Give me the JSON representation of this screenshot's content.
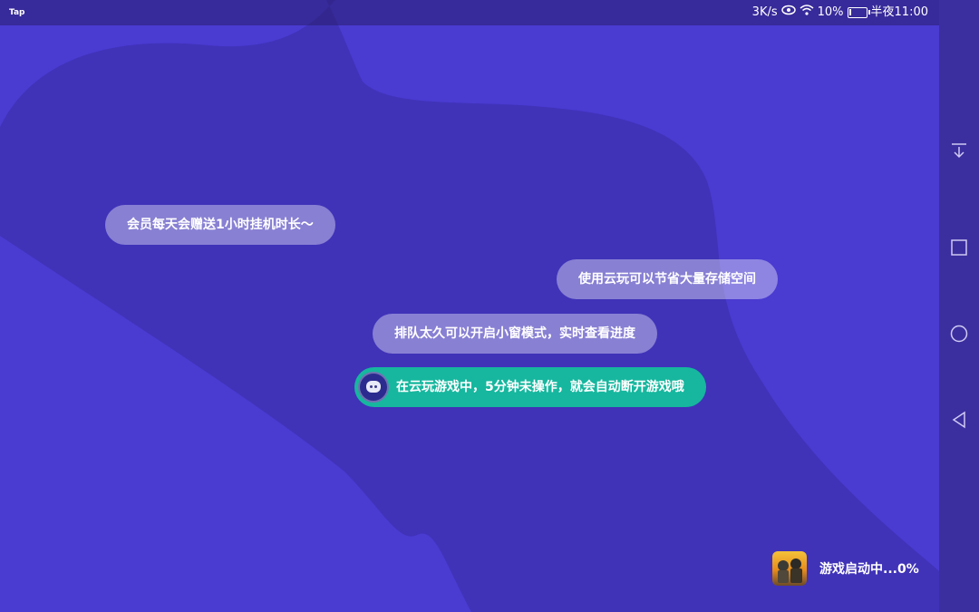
{
  "colors": {
    "background": "#4a3bd1",
    "background_dark": "#3f33b6",
    "navbar": "#3b2f9f",
    "bubble": "rgba(255,255,255,0.38)",
    "bubble_active": "#16b79e"
  },
  "statusbar": {
    "app_label": "Tap",
    "network_speed": "3K/s",
    "battery_percent": "10%",
    "time": "半夜11:00"
  },
  "tips": [
    "会员每天会赠送1小时挂机时长～",
    "使用云玩可以节省大量存储空间",
    "排队太久可以开启小窗模式，实时查看进度",
    "在云玩游戏中，5分钟未操作，就会自动断开游戏哦"
  ],
  "launch": {
    "status": "游戏启动中...0%"
  },
  "navbar": {
    "icons": [
      "download-icon",
      "recent-apps-icon",
      "home-icon",
      "back-icon"
    ]
  }
}
